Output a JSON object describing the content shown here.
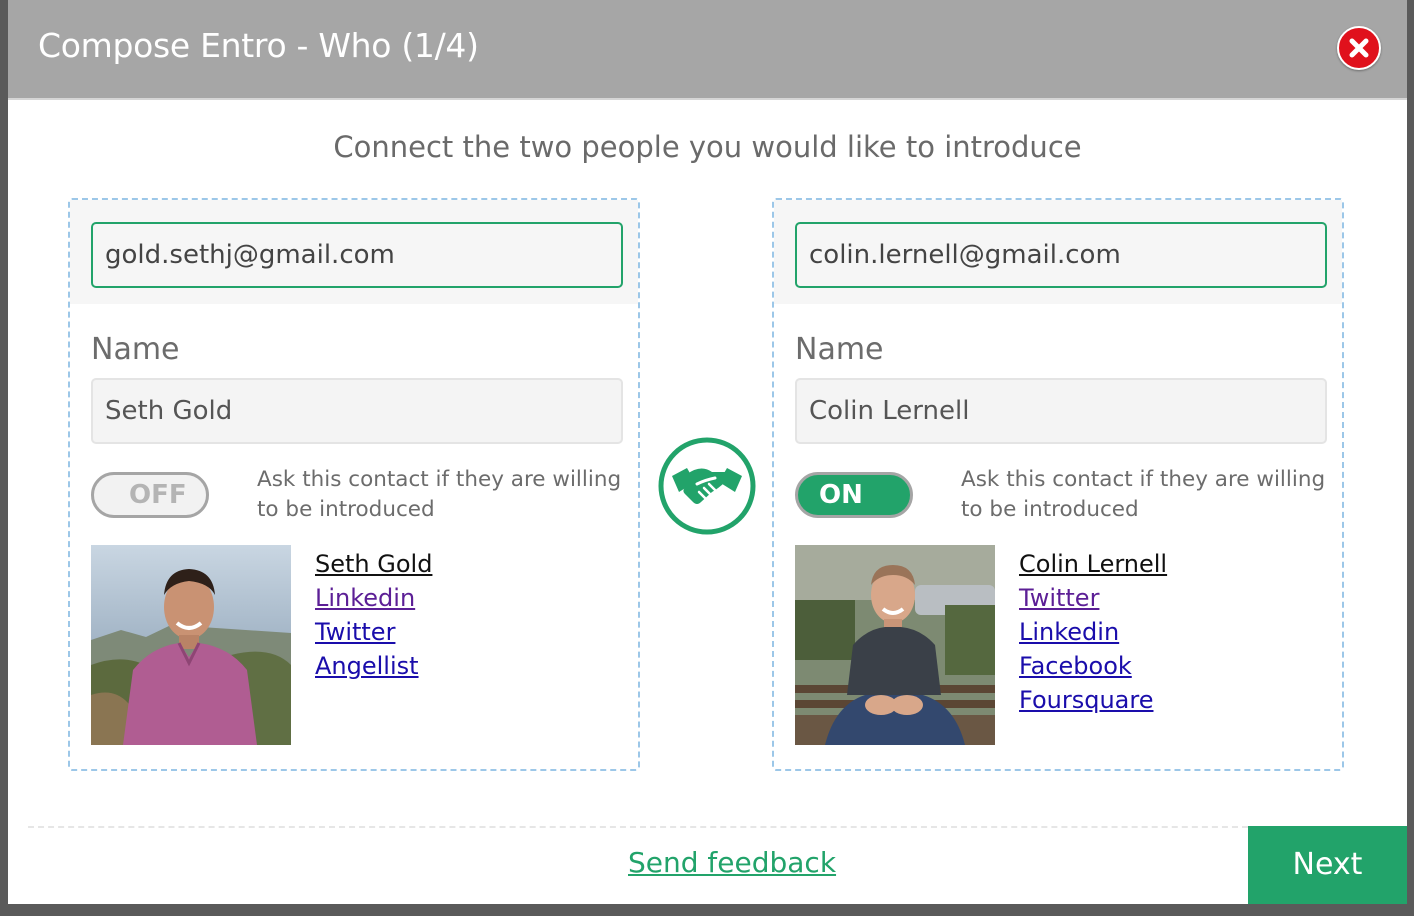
{
  "header": {
    "title": "Compose Entro - Who (1/4)",
    "close_icon": "close-icon"
  },
  "subtitle": "Connect the two people you would like to introduce",
  "colors": {
    "brand_green": "#22a36a",
    "header_gray": "#a6a6a6",
    "close_red": "#e0111c"
  },
  "left": {
    "email": "gold.sethj@gmail.com",
    "name_label": "Name",
    "name": "Seth Gold",
    "toggle": "OFF",
    "ask_text": "Ask this contact if they are willing to be introduced",
    "links": [
      "Seth Gold",
      "Linkedin",
      "Twitter",
      "Angellist"
    ]
  },
  "right": {
    "email": "colin.lernell@gmail.com",
    "name_label": "Name",
    "name": "Colin Lernell",
    "toggle": "ON",
    "ask_text": "Ask this contact if they are willing to be introduced",
    "links": [
      "Colin Lernell",
      "Twitter",
      "Linkedin",
      "Facebook",
      "Foursquare"
    ]
  },
  "center_icon": "handshake-icon",
  "footer": {
    "feedback": "Send feedback",
    "next": "Next"
  }
}
